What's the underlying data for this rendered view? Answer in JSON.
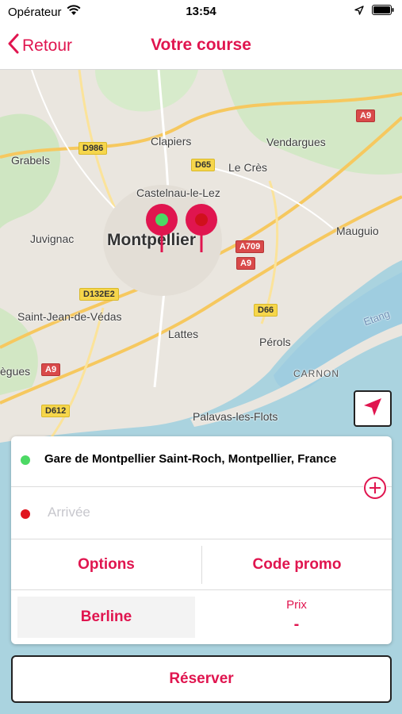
{
  "status_bar": {
    "carrier": "Opérateur",
    "time": "13:54",
    "wifi_icon": "wifi-icon",
    "location_icon": "location-arrow-icon",
    "battery_icon": "battery-icon"
  },
  "nav": {
    "back_label": "Retour",
    "title": "Votre course",
    "accent_color": "#e0154f"
  },
  "map": {
    "places": [
      "Clapiers",
      "Vendargues",
      "Grabels",
      "Le Crès",
      "Castelnau-le-Lez",
      "Montpellier",
      "Mauguio",
      "Juvignac",
      "Saint-Jean-de-Védas",
      "Lattes",
      "Pérols",
      "ègues",
      "CARNON",
      "Palavas-les-Flots",
      "Etang"
    ],
    "roads": [
      "A9",
      "D986",
      "D65",
      "A709",
      "A9",
      "D132E2",
      "D66",
      "A9",
      "D612"
    ],
    "pins": [
      {
        "kind": "departure",
        "color": "#4cd964"
      },
      {
        "kind": "arrival",
        "color": "#e0151f"
      }
    ]
  },
  "booking": {
    "departure": "Gare de Montpellier Saint-Roch, Montpellier, France",
    "arrival_placeholder": "Arrivée",
    "options_label": "Options",
    "promo_label": "Code promo",
    "vehicle_label": "Berline",
    "price_label": "Prix",
    "price_value": "-",
    "book_label": "Réserver"
  }
}
